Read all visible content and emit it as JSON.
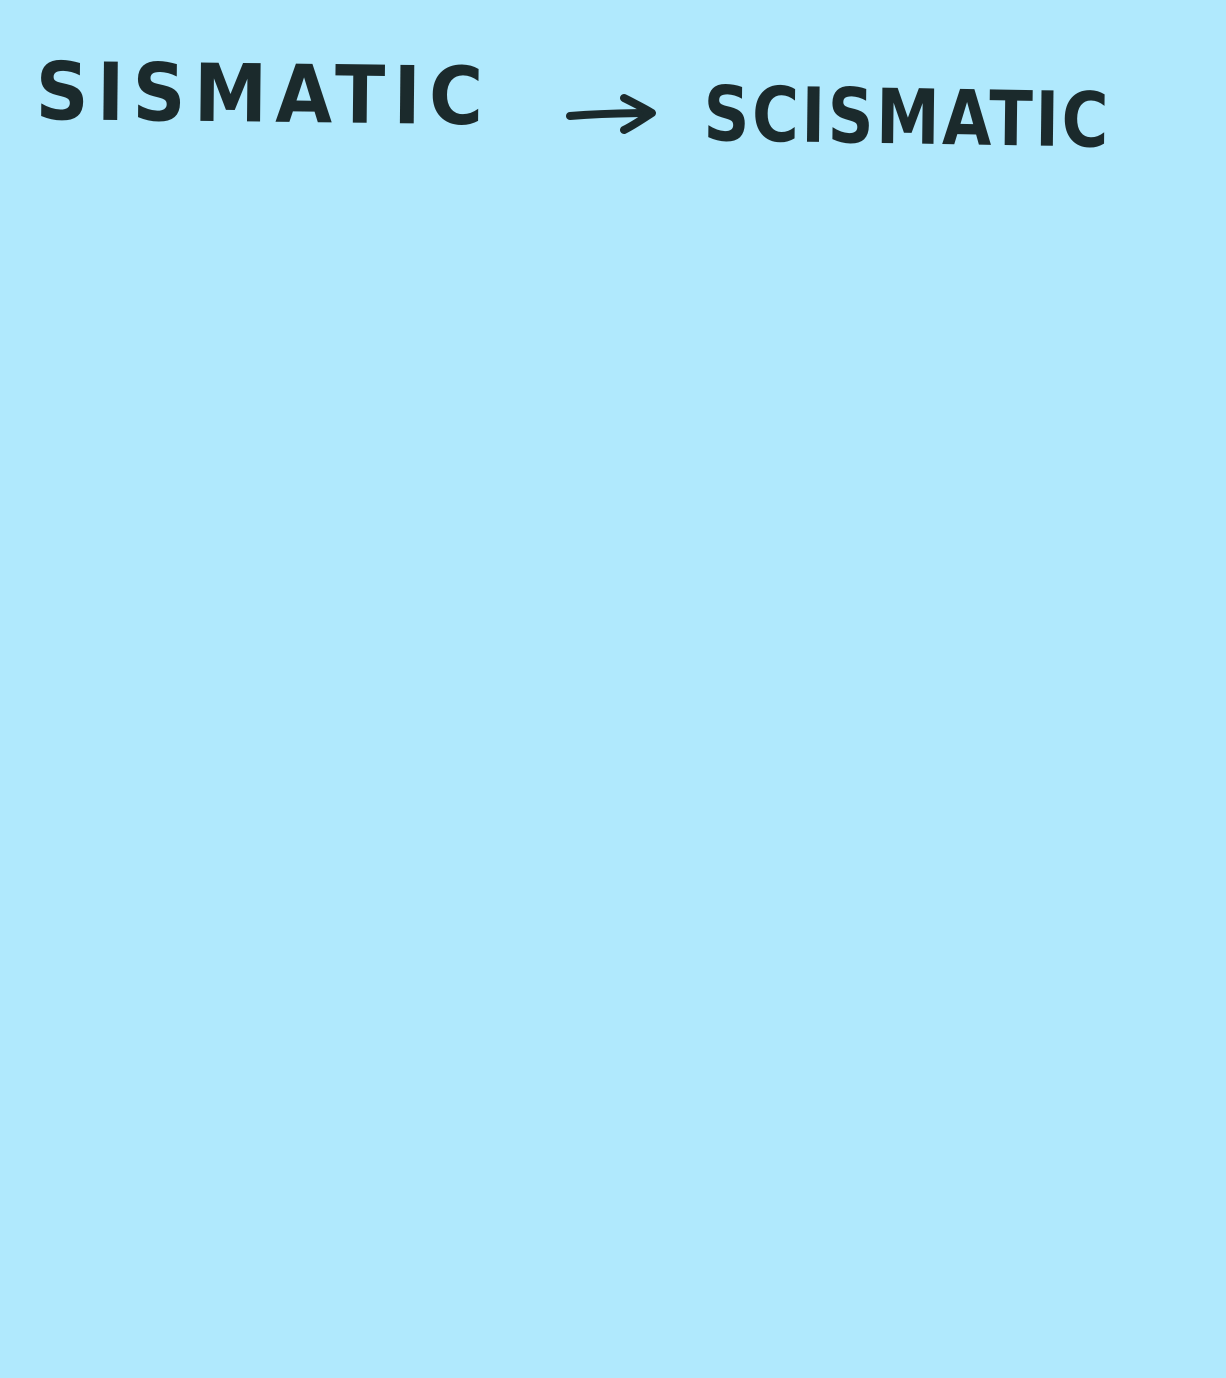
{
  "note": {
    "background_color": "#b0e9fd",
    "ink_color": "#1b2a2c",
    "misspelling": "SISMATIC",
    "correction": "SCISMATIC",
    "arrow_icon": "right-arrow-icon"
  }
}
